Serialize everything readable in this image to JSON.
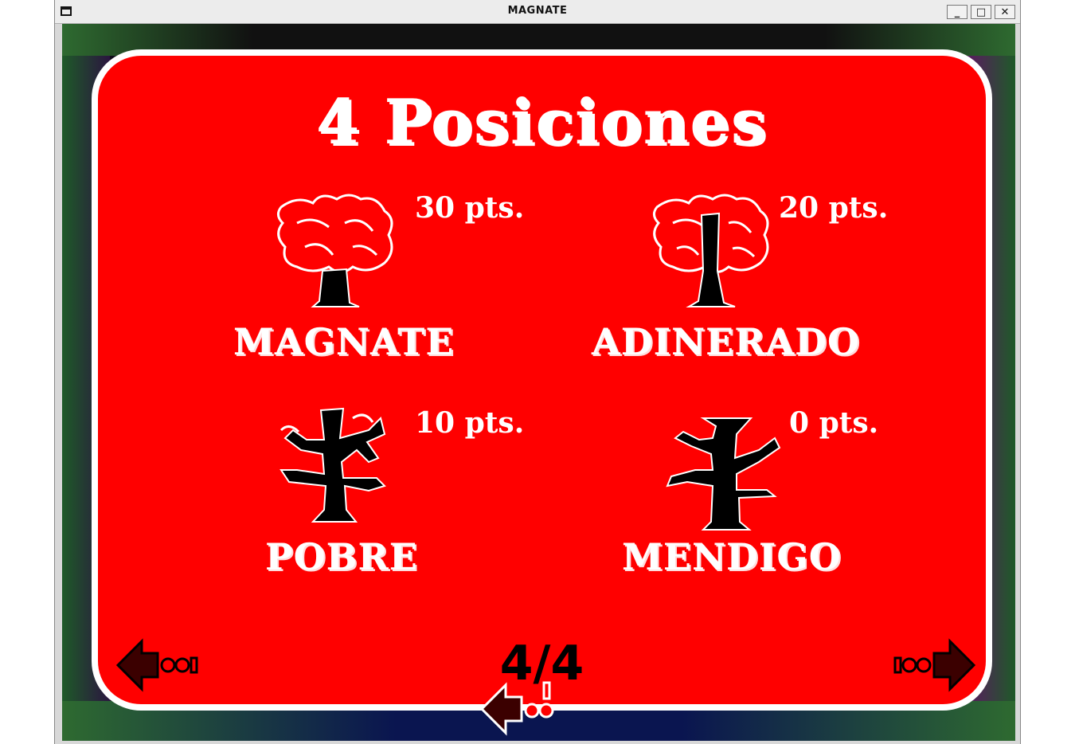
{
  "window": {
    "title": "MAGNATE"
  },
  "screen": {
    "title": "4 Posiciones",
    "positions": [
      {
        "label": "MAGNATE",
        "points": "30 pts.",
        "tree_icon": "leafy-tree-icon"
      },
      {
        "label": "ADINERADO",
        "points": "20 pts.",
        "tree_icon": "half-leafy-tree-icon"
      },
      {
        "label": "POBRE",
        "points": "10 pts.",
        "tree_icon": "bare-branch-tree-icon"
      },
      {
        "label": "MENDIGO",
        "points": "0 pts.",
        "tree_icon": "dead-tree-icon"
      }
    ],
    "page_indicator": "4/4"
  },
  "colors": {
    "panel": "#ff0000",
    "text": "#ffffff",
    "arrow": "#3b0000"
  }
}
